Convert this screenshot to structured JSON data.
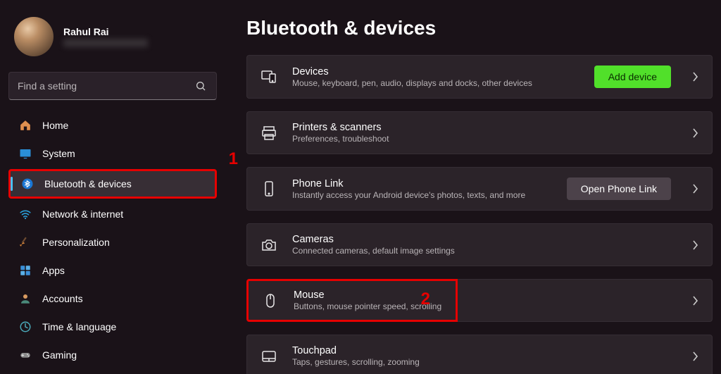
{
  "user": {
    "name": "Rahul Rai"
  },
  "search": {
    "placeholder": "Find a setting"
  },
  "nav": [
    {
      "label": "Home"
    },
    {
      "label": "System"
    },
    {
      "label": "Bluetooth & devices"
    },
    {
      "label": "Network & internet"
    },
    {
      "label": "Personalization"
    },
    {
      "label": "Apps"
    },
    {
      "label": "Accounts"
    },
    {
      "label": "Time & language"
    },
    {
      "label": "Gaming"
    }
  ],
  "page": {
    "title": "Bluetooth & devices"
  },
  "cards": {
    "devices": {
      "title": "Devices",
      "sub": "Mouse, keyboard, pen, audio, displays and docks, other devices",
      "action": "Add device"
    },
    "printers": {
      "title": "Printers & scanners",
      "sub": "Preferences, troubleshoot"
    },
    "phone": {
      "title": "Phone Link",
      "sub": "Instantly access your Android device's photos, texts, and more",
      "action": "Open Phone Link"
    },
    "cameras": {
      "title": "Cameras",
      "sub": "Connected cameras, default image settings"
    },
    "mouse": {
      "title": "Mouse",
      "sub": "Buttons, mouse pointer speed, scrolling"
    },
    "touchpad": {
      "title": "Touchpad",
      "sub": "Taps, gestures, scrolling, zooming"
    }
  },
  "annotations": {
    "one": "1",
    "two": "2"
  }
}
